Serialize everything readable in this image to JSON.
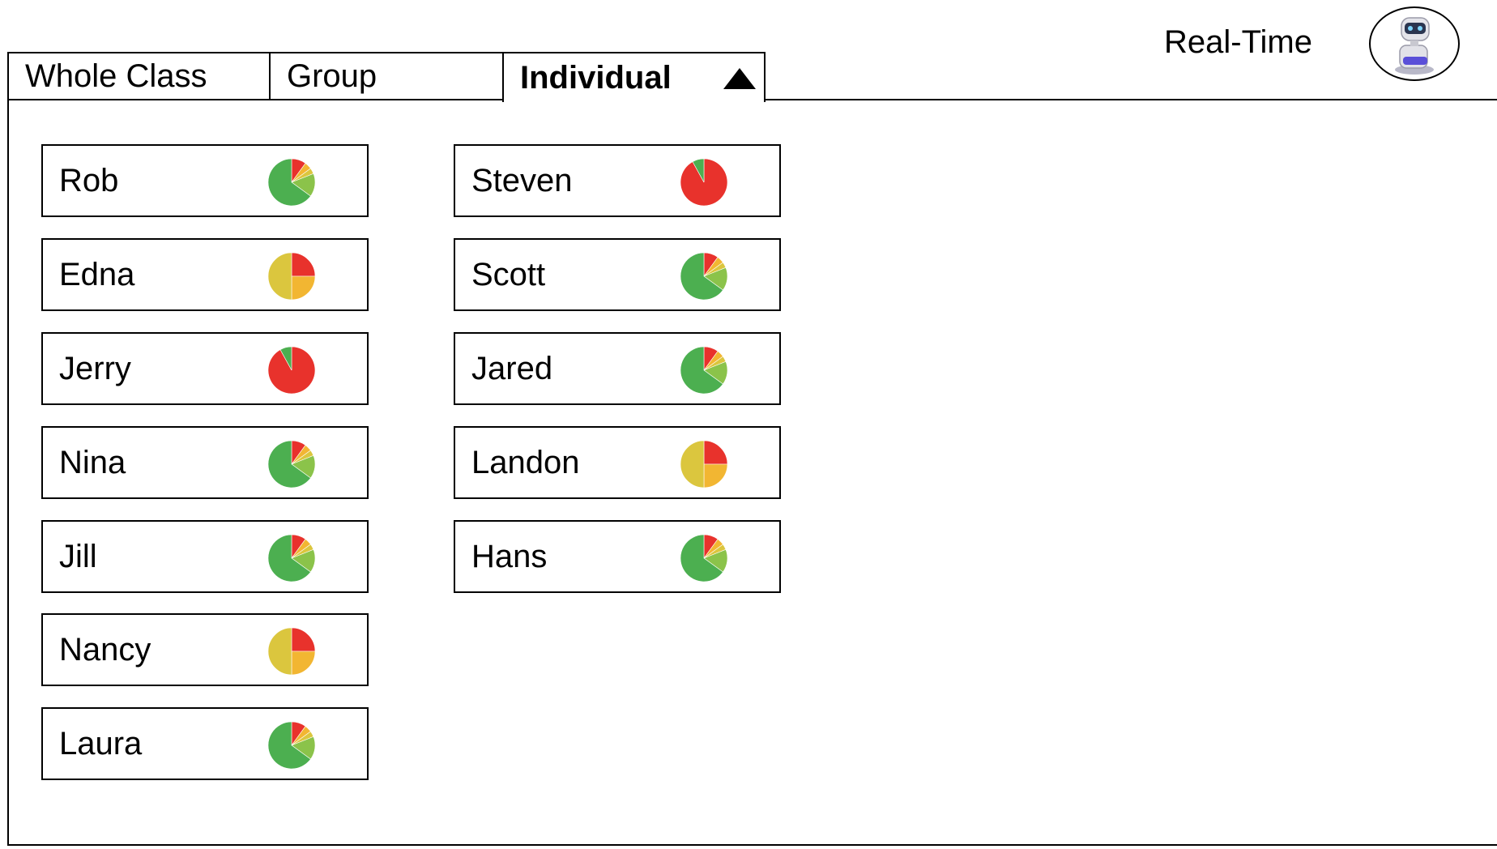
{
  "tabs": [
    {
      "label": "Whole Class",
      "active": false
    },
    {
      "label": "Group",
      "active": false
    },
    {
      "label": "Individual",
      "active": true
    }
  ],
  "header": {
    "realtime_label": "Real-Time",
    "avatar_icon": "robot-avatar-icon"
  },
  "colors": {
    "green": "#4caf50",
    "light_green": "#8bc34a",
    "yellow": "#dbc63e",
    "orange": "#f2b632",
    "red": "#e8322c"
  },
  "students": [
    {
      "name": "Rob",
      "mix": "mostly-green"
    },
    {
      "name": "Edna",
      "mix": "mixed-yellow"
    },
    {
      "name": "Jerry",
      "mix": "mostly-red"
    },
    {
      "name": "Nina",
      "mix": "mostly-green"
    },
    {
      "name": "Jill",
      "mix": "mostly-green"
    },
    {
      "name": "Nancy",
      "mix": "mixed-yellow"
    },
    {
      "name": "Laura",
      "mix": "mostly-green"
    },
    {
      "name": "Steven",
      "mix": "mostly-red"
    },
    {
      "name": "Scott",
      "mix": "mostly-green"
    },
    {
      "name": "Jared",
      "mix": "mostly-green"
    },
    {
      "name": "Landon",
      "mix": "mixed-yellow"
    },
    {
      "name": "Hans",
      "mix": "mostly-green"
    }
  ]
}
